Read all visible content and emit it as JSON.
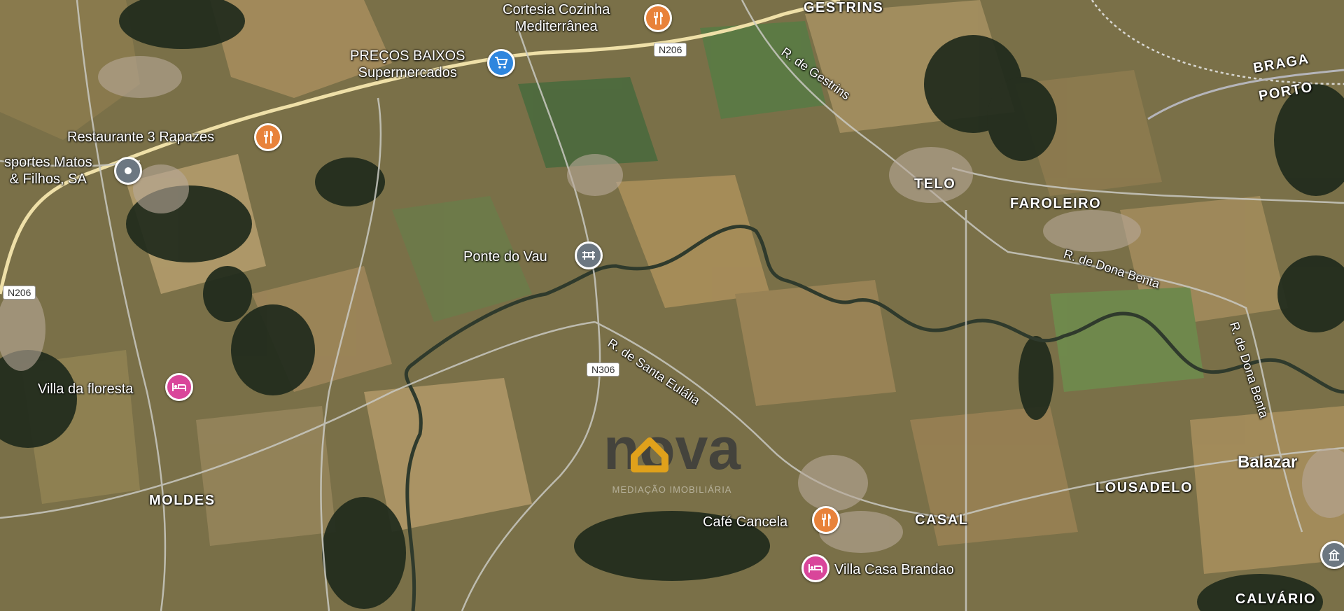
{
  "colors": {
    "pin_food": "#e8823a",
    "pin_shop": "#2e86de",
    "pin_lodging": "#d9469a",
    "pin_generic": "#6c7781",
    "watermark_dark": "#3b3b3b",
    "watermark_accent": "#e0a11b"
  },
  "places": {
    "gestrins": "GESTRINS",
    "telo": "TELO",
    "faroleiro": "FAROLEIRO",
    "moldes": "MOLDES",
    "casal": "CASAL",
    "lousadelo": "LOUSADELO",
    "calvario": "CALVÁRIO",
    "balazar": "Balazar",
    "braga": "BRAGA",
    "porto": "PORTO"
  },
  "roads": {
    "n206_top": "N206",
    "n206_left": "N206",
    "n306": "N306",
    "r_gestrins": "R. de Gestrins",
    "r_dona_benta_h": "R. de Dona Benta",
    "r_dona_benta_v": "R. de Dona Benta",
    "r_santa_eulalia": "R. de Santa Eulália"
  },
  "pois": {
    "cortesia": {
      "line1": "Cortesia Cozinha",
      "line2": "Mediterrânea",
      "icon": "restaurant-icon"
    },
    "precos": {
      "line1": "PREÇOS BAIXOS",
      "line2": "Supermercados",
      "icon": "shopping-cart-icon"
    },
    "rest3": {
      "label": "Restaurante 3 Rapazes",
      "icon": "restaurant-icon"
    },
    "desportes": {
      "line1": "sportes Matos",
      "line2": "& Filhos, SA",
      "icon": "location-dot-icon"
    },
    "ponte": {
      "label": "Ponte do Vau",
      "icon": "bridge-icon"
    },
    "villa_floresta": {
      "label": "Villa da floresta",
      "icon": "bed-icon"
    },
    "cafe_cancela": {
      "label": "Café Cancela",
      "icon": "restaurant-icon"
    },
    "villa_casa": {
      "label": "Villa Casa Brandao",
      "icon": "bed-icon"
    },
    "edge_pin": {
      "icon": "building-icon"
    }
  },
  "watermark": {
    "brand": "nova",
    "subtitle": "MEDIAÇÃO IMOBILIÁRIA"
  }
}
